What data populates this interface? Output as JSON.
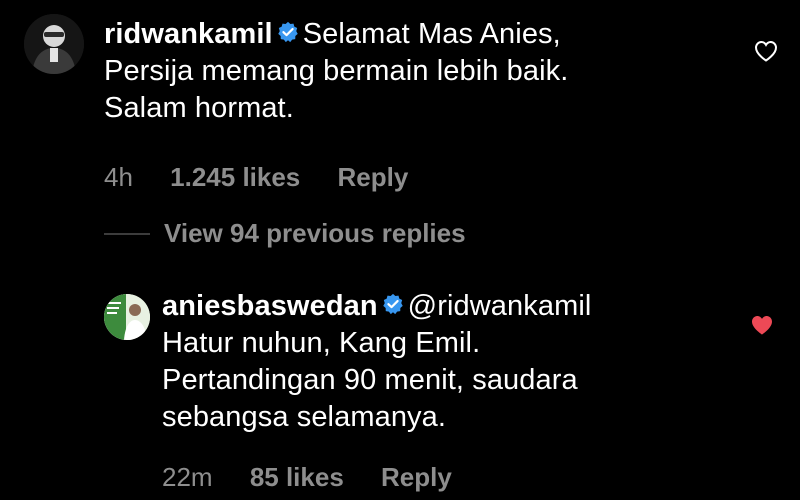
{
  "comments": [
    {
      "username": "ridwankamil",
      "verified": true,
      "text_lines": [
        "Selamat Mas Anies,",
        "Persija memang bermain lebih baik.",
        "Salam hormat."
      ],
      "time": "4h",
      "likes": "1.245 likes",
      "reply": "Reply",
      "liked": false
    },
    {
      "username": "aniesbaswedan",
      "verified": true,
      "mention": "@ridwankamil",
      "text_lines": [
        "Hatur nuhun, Kang Emil.",
        "Pertandingan 90 menit, saudara",
        "sebangsa selamanya."
      ],
      "time": "22m",
      "likes": "85 likes",
      "reply": "Reply",
      "liked": true
    }
  ],
  "view_replies": "View 94 previous replies",
  "colors": {
    "background": "#000000",
    "text": "#ffffff",
    "muted": "#8e8e8e",
    "verified_blue": "#3897f0",
    "heart_red": "#ed4956"
  }
}
